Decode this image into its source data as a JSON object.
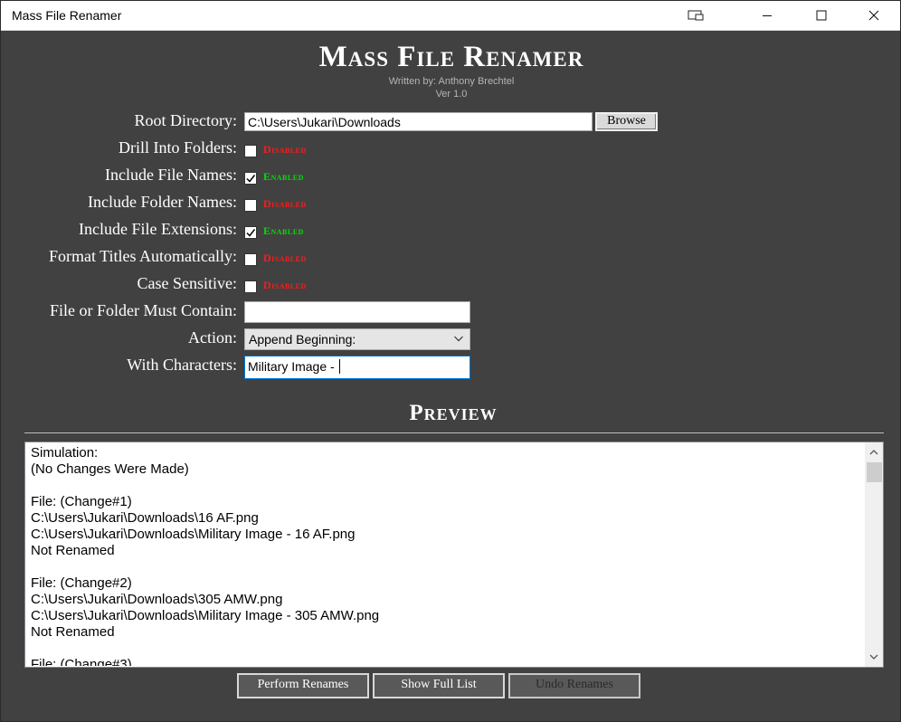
{
  "window": {
    "title": "Mass File Renamer"
  },
  "header": {
    "title": "Mass File Renamer",
    "author": "Written by: Anthony Brechtel",
    "version": "Ver 1.0"
  },
  "form": {
    "root_directory": {
      "label": "Root Directory:",
      "value": "C:\\Users\\Jukari\\Downloads",
      "browse_label": "Browse"
    },
    "options": [
      {
        "label": "Drill Into Folders:",
        "checked": false,
        "state": "Disabled"
      },
      {
        "label": "Include File Names:",
        "checked": true,
        "state": "Enabled"
      },
      {
        "label": "Include Folder Names:",
        "checked": false,
        "state": "Disabled"
      },
      {
        "label": "Include File Extensions:",
        "checked": true,
        "state": "Enabled"
      },
      {
        "label": "Format Titles Automatically:",
        "checked": false,
        "state": "Disabled"
      },
      {
        "label": "Case Sensitive:",
        "checked": false,
        "state": "Disabled"
      }
    ],
    "must_contain": {
      "label": "File or Folder Must Contain:",
      "value": ""
    },
    "action": {
      "label": "Action:",
      "selected": "Append Beginning:"
    },
    "with_characters": {
      "label": "With Characters:",
      "value": "Military Image - "
    }
  },
  "preview": {
    "heading": "Preview",
    "lines": [
      "Simulation:",
      "(No Changes Were Made)",
      "",
      "File: (Change#1)",
      "C:\\Users\\Jukari\\Downloads\\16 AF.png",
      "C:\\Users\\Jukari\\Downloads\\Military Image - 16 AF.png",
      "Not Renamed",
      "",
      "File: (Change#2)",
      "C:\\Users\\Jukari\\Downloads\\305 AMW.png",
      "C:\\Users\\Jukari\\Downloads\\Military Image - 305 AMW.png",
      "Not Renamed",
      "",
      "File: (Change#3)"
    ]
  },
  "buttons": {
    "perform": "Perform Renames",
    "show_full": "Show Full List",
    "undo": "Undo Renames"
  },
  "colors": {
    "background": "#414141",
    "enabled": "#00e000",
    "disabled": "#ff1a1a"
  }
}
